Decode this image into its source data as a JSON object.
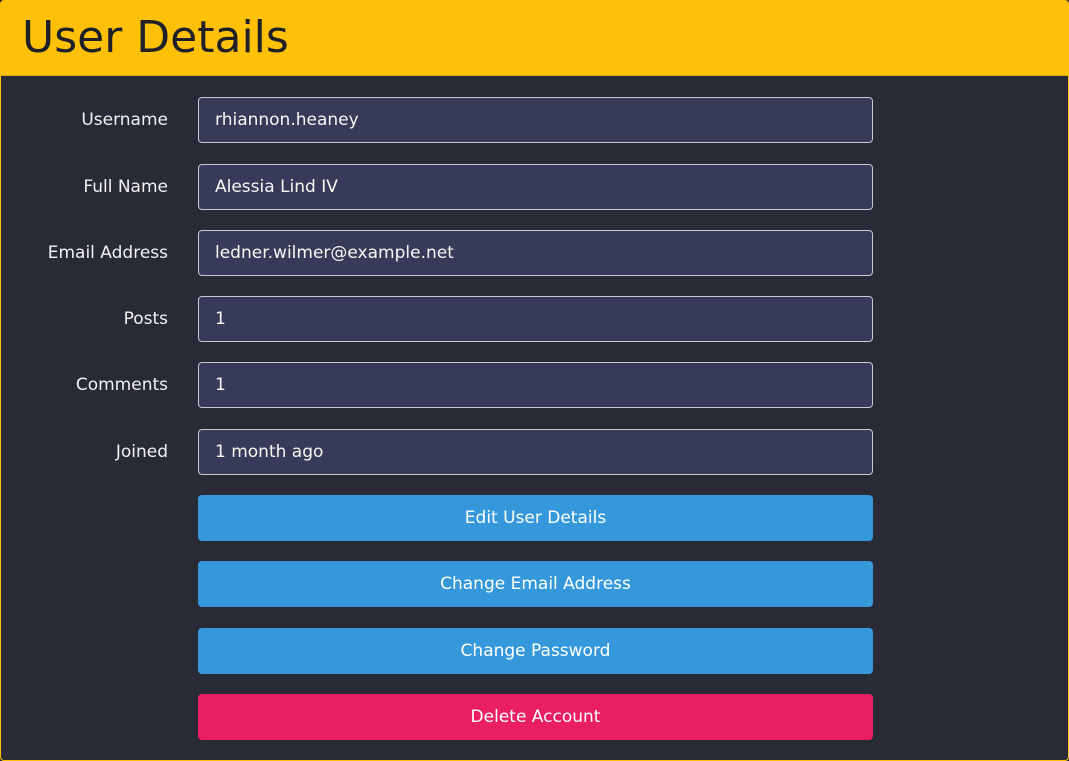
{
  "header": {
    "title": "User Details"
  },
  "fields": [
    {
      "label": "Username",
      "value": "rhiannon.heaney"
    },
    {
      "label": "Full Name",
      "value": "Alessia Lind IV"
    },
    {
      "label": "Email Address",
      "value": "ledner.wilmer@example.net"
    },
    {
      "label": "Posts",
      "value": "1"
    },
    {
      "label": "Comments",
      "value": "1"
    },
    {
      "label": "Joined",
      "value": "1 month ago"
    }
  ],
  "actions": {
    "edit_label": "Edit User Details",
    "change_email_label": "Change Email Address",
    "change_password_label": "Change Password",
    "delete_label": "Delete Account"
  },
  "colors": {
    "header_bg": "#ffc107",
    "page_bg": "#282a36",
    "input_bg": "#383a59",
    "primary_button": "#3498db",
    "danger_button": "#e91e63"
  }
}
